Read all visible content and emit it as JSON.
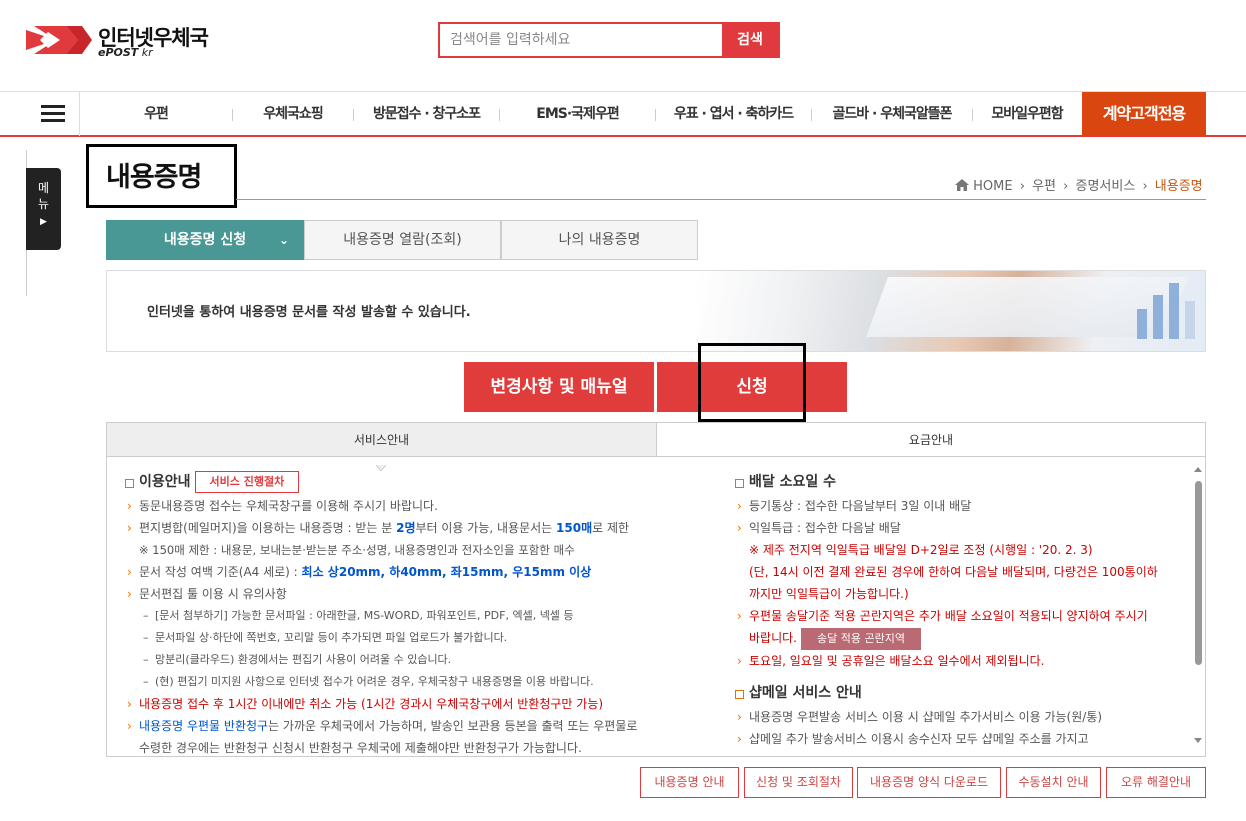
{
  "header": {
    "logo_text": "인터넷우체국",
    "logo_sub_brand": "ePOST",
    "logo_sub_tld": " kr",
    "search_placeholder": "검색어를 입력하세요",
    "search_button": "검색"
  },
  "gnb": {
    "items": [
      "우편",
      "우체국쇼핑",
      "방문접수 · 창구소포",
      "EMS·국제우편",
      "우표 · 엽서 · 축하카드",
      "골드바 · 우체국알뜰폰",
      "모바일우편함"
    ],
    "special": "계약고객전용"
  },
  "side_menu_label": [
    "메",
    "뉴"
  ],
  "page": {
    "title": "내용증명",
    "breadcrumb": [
      "HOME",
      "우편",
      "증명서비스",
      "내용증명"
    ]
  },
  "tabs": [
    "내용증명 신청",
    "내용증명 열람(조회)",
    "나의 내용증명"
  ],
  "banner_text": "인터넷을 통하여 내용증명 문서를 작성 발송할 수 있습니다.",
  "buttons": {
    "manual": "변경사항 및 매뉴얼",
    "apply": "신청"
  },
  "info_tabs": [
    "서비스안내",
    "요금안내"
  ],
  "usage": {
    "heading": "이용안내",
    "process_button": "서비스 진행절차",
    "l1": "동문내용증명 접수는 우체국창구를 이용해 주시기 바랍니다.",
    "l2a": "편지병합(메일머지)을 이용하는 내용증명 : 받는 분 ",
    "l2b": "2명",
    "l2c": "부터 이용 가능, 내용문서는 ",
    "l2d": "150매",
    "l2e": "로 제한",
    "l3": "※ 150매 제한 : 내용문, 보내는분·받는분 주소·성명, 내용증명인과 전자소인을 포함한 매수",
    "l4a": "문서 작성 여백 기준(A4 세로) : ",
    "l4b": "최소 상20mm, 하40mm, 좌15mm, 우15mm 이상",
    "l5": "문서편집 툴 이용 시 유의사항",
    "s1": "[문서 첨부하기] 가능한 문서파일 : 아래한글, MS-WORD, 파워포인트, PDF, 엑셀, 넥셀 등",
    "s2": "문서파일 상·하단에 쪽번호, 꼬리말 등이 추가되면 파일 업로드가 불가합니다.",
    "s3": "망분리(클라우드) 환경에서는 편집기 사용이 어려울 수 있습니다.",
    "s4": "(현) 편집기 미지원 사항으로 인터넷 접수가 어려운 경우, 우체국창구 내용증명을 이용 바랍니다.",
    "l6": "내용증명 접수 후 1시간 이내에만 취소 가능 (1시간 경과시 우체국창구에서 반환청구만 가능)",
    "l7a": "내용증명 우편물 반환청구",
    "l7b": "는 가까운 우체국에서 가능하며, 발송인 보관용 등본을 출력 또는 우편물로",
    "l7c": "수령한 경우에는 반환청구 신청시 반환청구 우체국에 제출해야만 반환청구가 가능합니다."
  },
  "delivery": {
    "heading": "배달 소요일 수",
    "d1": "등기통상 : 접수한 다음날부터 3일 이내 배달",
    "d2": "익일특급 : 접수한 다음날 배달",
    "d3": "※ 제주 전지역 익일특급 배달일 D+2일로 조정 (시행일 : '20. 2. 3)",
    "d4": "(단, 14시 이전 결제 완료된 경우에 한하여 다음날 배달되며, 다량건은 100통이하",
    "d5": "까지만 익일특급이 가능합니다.)",
    "d6": "우편물 송달기준 적용 곤란지역은 추가 배달 소요일이 적용되니 양지하여 주시기",
    "d7": "바랍니다.",
    "area_button": "송달 적용 곤란지역",
    "d8": "토요일, 일요일 및 공휴일은 배달소요 일수에서 제외됩니다."
  },
  "shopmail": {
    "heading": "샵메일 서비스 안내",
    "m1": "내용증명 우편발송 서비스 이용 시 샵메일 추가서비스 이용 가능(원/통)",
    "m2": "샵메일 추가 발송서비스 이용시 송수신자 모두 샵메일 주소를 가지고"
  },
  "footer_buttons": [
    "내용증명 안내",
    "신청 및 조회절차",
    "내용증명 양식 다운로드",
    "수동설치 안내",
    "오류 해결안내"
  ],
  "colors": {
    "brand_red": "#e03a3e",
    "teal": "#4a9896",
    "orange": "#d9460f"
  }
}
